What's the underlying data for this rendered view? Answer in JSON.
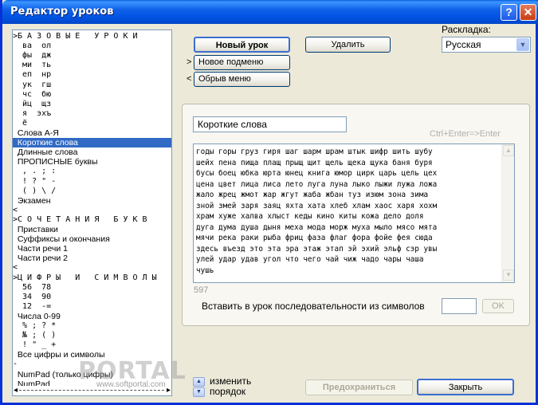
{
  "window": {
    "title": "Редактор уроков",
    "help_glyph": "?",
    "close_glyph": "✕"
  },
  "tree": {
    "items": [
      {
        "text": ">Б А З О В Ы Е   У Р О К И",
        "selected": false,
        "sans": false
      },
      {
        "text": "  ва  ол",
        "selected": false,
        "sans": false
      },
      {
        "text": "  фы  дж",
        "selected": false,
        "sans": false
      },
      {
        "text": "  ми  ть",
        "selected": false,
        "sans": false
      },
      {
        "text": "  еп  нр",
        "selected": false,
        "sans": false
      },
      {
        "text": "  ук  гш",
        "selected": false,
        "sans": false
      },
      {
        "text": "  чс  бю",
        "selected": false,
        "sans": false
      },
      {
        "text": "  йц  щз",
        "selected": false,
        "sans": false
      },
      {
        "text": "  я  эхъ",
        "selected": false,
        "sans": false
      },
      {
        "text": "  ё",
        "selected": false,
        "sans": false
      },
      {
        "text": "  Слова А-Я",
        "selected": false,
        "sans": true
      },
      {
        "text": "  Короткие слова",
        "selected": true,
        "sans": true
      },
      {
        "text": "  Длинные слова",
        "selected": false,
        "sans": true
      },
      {
        "text": "  ПРОПИСНЫЕ буквы",
        "selected": false,
        "sans": true
      },
      {
        "text": "  , . ; :",
        "selected": false,
        "sans": false
      },
      {
        "text": "  ! ? \" -",
        "selected": false,
        "sans": false
      },
      {
        "text": "  ( ) \\ /",
        "selected": false,
        "sans": false
      },
      {
        "text": "  Экзамен",
        "selected": false,
        "sans": true
      },
      {
        "text": "<",
        "selected": false,
        "sans": false
      },
      {
        "text": ">С О Ч Е Т А Н И Я   Б У К В",
        "selected": false,
        "sans": false
      },
      {
        "text": "  Приставки",
        "selected": false,
        "sans": true
      },
      {
        "text": "  Суффиксы и окончания",
        "selected": false,
        "sans": true
      },
      {
        "text": "  Части речи 1",
        "selected": false,
        "sans": true
      },
      {
        "text": "  Части речи 2",
        "selected": false,
        "sans": true
      },
      {
        "text": "<",
        "selected": false,
        "sans": false
      },
      {
        "text": ">Ц И Ф Р Ы   И   С И М В О Л Ы",
        "selected": false,
        "sans": false
      },
      {
        "text": "  56  78",
        "selected": false,
        "sans": false
      },
      {
        "text": "  34  90",
        "selected": false,
        "sans": false
      },
      {
        "text": "  12  -=",
        "selected": false,
        "sans": false
      },
      {
        "text": "  Числа 0-99",
        "selected": false,
        "sans": true
      },
      {
        "text": "  % ; ? *",
        "selected": false,
        "sans": false
      },
      {
        "text": "  № ; ( )",
        "selected": false,
        "sans": false
      },
      {
        "text": "  ! \" _ +",
        "selected": false,
        "sans": false
      },
      {
        "text": "  Все цифры и символы",
        "selected": false,
        "sans": true
      },
      {
        "text": "-",
        "selected": false,
        "sans": false
      },
      {
        "text": "  NumPad (только цифры)",
        "selected": false,
        "sans": true
      },
      {
        "text": "  NumPad",
        "selected": false,
        "sans": true
      }
    ],
    "scroll_left": "◂",
    "scroll_right": "▸"
  },
  "buttons": {
    "new_lesson": "Новый урок",
    "delete": "Удалить",
    "new_submenu": "Новое подменю",
    "break_menu": "Обрыв меню",
    "submenu_marker": ">",
    "break_marker": "<",
    "ok": "OK",
    "save": "Предохраниться",
    "close": "Закрыть"
  },
  "layout": {
    "label": "Раскладка:",
    "selected": "Русская",
    "arrow": "▼"
  },
  "editor": {
    "lesson_title": "Короткие слова",
    "hint": "Ctrl+Enter=>Enter",
    "lines": [
      "годы горы груз гиря шаг шарм шрам штык шифр шить шубу",
      "шейх пена пища плащ прыщ щит щель щека щука баня буря",
      "бусы боец юбка юрта юнец книга юмор цирк царь цель цех",
      "цена цвет лица лиса лето луга луна лыко лыжи лужа ложа",
      "жало жрец жмот жар жгут жаба жбан туз изюм зона зима",
      "зной змей заря заяц яхта хата хлеб хлам хаос харя хохм",
      "храм хуже халва хлыст кеды кино киты кожа дело доля",
      "дуга дума душа дыня меха мода морж муха мыло мясо мята",
      "мячи река раки рыба фриц фаза флаг фора фойе фея сюда",
      "здесь въезд это эта эра этаж этап эй эхий эльф сэр увы",
      "улей удар удав угол что чего чай чиж чадо чары чаша",
      "чушь"
    ],
    "char_count": "597",
    "scroll_up": "▲",
    "scroll_down": "▼"
  },
  "insert": {
    "label": "Вставить в урок последовательности из символов",
    "value": ""
  },
  "reorder": {
    "label": "изменить порядок",
    "up": "▲",
    "down": "▼"
  },
  "watermark": {
    "text": "PORTAL",
    "url": "www.softportal.com"
  }
}
